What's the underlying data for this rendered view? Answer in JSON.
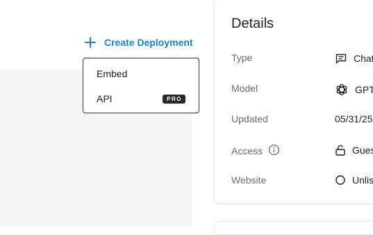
{
  "toolbar": {
    "create_deployment_label": "Create Deployment"
  },
  "dropdown": {
    "items": [
      {
        "label": "Embed"
      },
      {
        "label": "API",
        "badge": "PRO"
      }
    ]
  },
  "details": {
    "title": "Details",
    "rows": [
      {
        "label": "Type",
        "value": "Chat",
        "icon": "chat-icon"
      },
      {
        "label": "Model",
        "value": "GPT-",
        "icon": "openai-logo-icon"
      },
      {
        "label": "Updated",
        "value": "05/31/25"
      },
      {
        "label": "Access",
        "value": "Gues",
        "icon": "lock-open-icon",
        "label_icon": "info-icon"
      },
      {
        "label": "Website",
        "value": "Unlis",
        "icon": "circle-icon"
      }
    ]
  },
  "colors": {
    "accent": "#1d7fc9",
    "badge_bg": "#2a2a2e",
    "panel_bg": "#f5f5f6"
  }
}
